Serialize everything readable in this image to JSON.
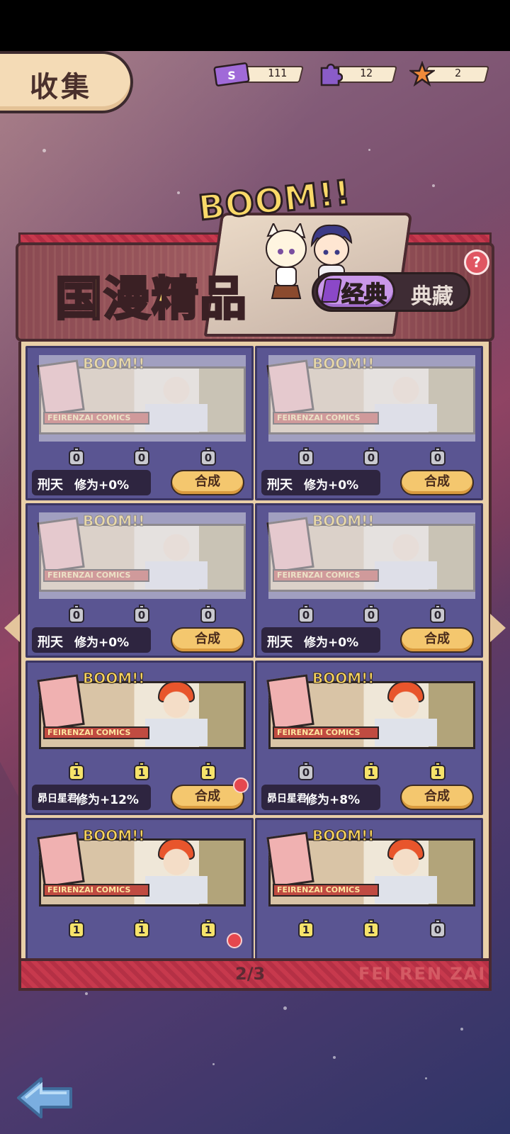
{
  "header": {
    "title": "收集",
    "currencies": [
      {
        "icon": "ticket-icon",
        "value": "111",
        "color": "#a06ad8"
      },
      {
        "icon": "puzzle-piece-icon",
        "value": "12",
        "color": "#8a5cc8"
      },
      {
        "icon": "star-icon",
        "value": "2",
        "color": "#f08a3a"
      }
    ]
  },
  "banner": {
    "boom": "BOOM!!",
    "title": "国漫精品",
    "tabs": [
      {
        "label": "经典",
        "active": true
      },
      {
        "label": "典藏",
        "active": false
      }
    ],
    "help": "?"
  },
  "cards": [
    {
      "art_boom": "BOOM!!",
      "art_brand": "FEIRENZAI COMICS",
      "pieces": [
        "0",
        "0",
        "0"
      ],
      "lit": [
        false,
        false,
        false
      ],
      "name": "刑天",
      "cultivation": "修为+0%",
      "button": "合成",
      "badge": false,
      "unlocked": false
    },
    {
      "art_boom": "BOOM!!",
      "art_brand": "FEIRENZAI COMICS",
      "pieces": [
        "0",
        "0",
        "0"
      ],
      "lit": [
        false,
        false,
        false
      ],
      "name": "刑天",
      "cultivation": "修为+0%",
      "button": "合成",
      "badge": false,
      "unlocked": false
    },
    {
      "art_boom": "BOOM!!",
      "art_brand": "FEIRENZAI COMICS",
      "pieces": [
        "0",
        "0",
        "0"
      ],
      "lit": [
        false,
        false,
        false
      ],
      "name": "刑天",
      "cultivation": "修为+0%",
      "button": "合成",
      "badge": false,
      "unlocked": false
    },
    {
      "art_boom": "BOOM!!",
      "art_brand": "FEIRENZAI COMICS",
      "pieces": [
        "0",
        "0",
        "0"
      ],
      "lit": [
        false,
        false,
        false
      ],
      "name": "刑天",
      "cultivation": "修为+0%",
      "button": "合成",
      "badge": false,
      "unlocked": false
    },
    {
      "art_boom": "BOOM!!",
      "art_brand": "FEIRENZAI COMICS",
      "pieces": [
        "1",
        "1",
        "1"
      ],
      "lit": [
        true,
        true,
        true
      ],
      "name": "昴日星君",
      "cultivation": "修为+12%",
      "button": "合成",
      "badge": true,
      "unlocked": true
    },
    {
      "art_boom": "BOOM!!",
      "art_brand": "FEIRENZAI COMICS",
      "pieces": [
        "0",
        "1",
        "1"
      ],
      "lit": [
        false,
        true,
        true
      ],
      "name": "昴日星君",
      "cultivation": "修为+8%",
      "button": "合成",
      "badge": false,
      "unlocked": true
    },
    {
      "art_boom": "BOOM!!",
      "art_brand": "FEIRENZAI COMICS",
      "pieces": [
        "1",
        "1",
        "1"
      ],
      "lit": [
        true,
        true,
        true
      ],
      "unlocked": true
    },
    {
      "art_boom": "BOOM!!",
      "art_brand": "FEIRENZAI COMICS",
      "pieces": [
        "1",
        "1",
        "0"
      ],
      "lit": [
        true,
        true,
        false
      ],
      "unlocked": true
    }
  ],
  "footer": {
    "page": "2/3",
    "brand": "FEI REN ZAI"
  }
}
